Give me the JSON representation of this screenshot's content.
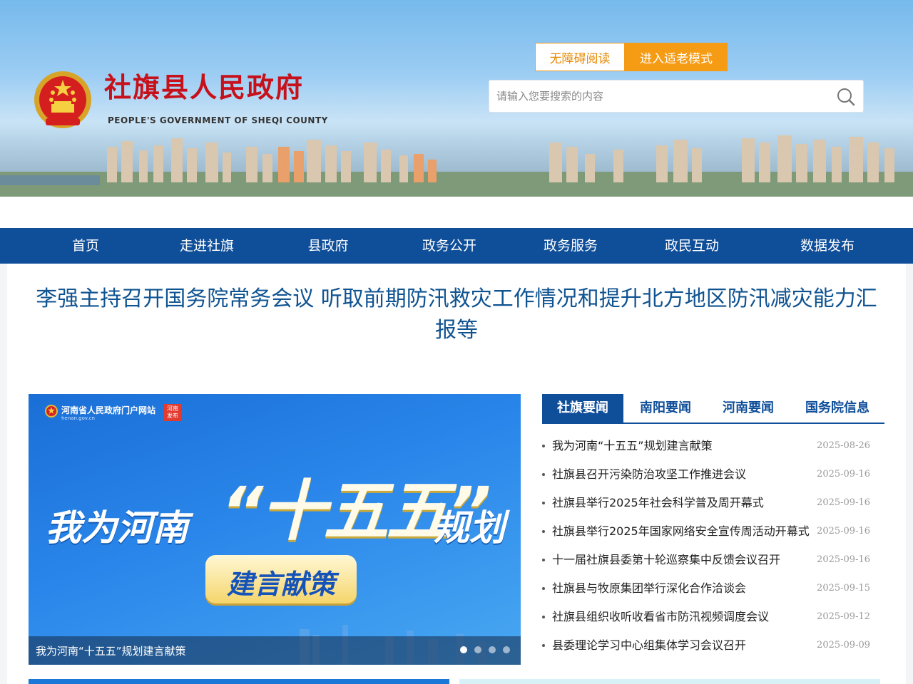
{
  "header": {
    "site_title": "社旗县人民政府",
    "site_subtitle": "PEOPLE'S GOVERNMENT OF  SHEQI COUNTY",
    "accessibility_label": "无障碍阅读",
    "elder_mode_label": "进入适老模式",
    "search_placeholder": "请输入您要搜索的内容"
  },
  "nav": {
    "items": [
      "首页",
      "走进社旗",
      "县政府",
      "政务公开",
      "政务服务",
      "政民互动",
      "数据发布"
    ]
  },
  "headline": "李强主持召开国务院常务会议 听取前期防汛救灾工作情况和提升北方地区防汛减灾能力汇报等",
  "banner": {
    "org_name": "河南省人民政府门户网站",
    "org_url": "henan.gov.cn",
    "badge": "河南发布",
    "text_left": "我为河南",
    "text_mid": "“十五五”",
    "text_right": "规划",
    "text_pill": "建言献策",
    "caption": "我为河南“十五五”规划建言献策",
    "slide_count": 4,
    "active_slide": 1
  },
  "news": {
    "tabs": [
      "社旗要闻",
      "南阳要闻",
      "河南要闻",
      "国务院信息"
    ],
    "active_tab": 0,
    "items": [
      {
        "title": "我为河南“十五五”规划建言献策",
        "date": "2025-08-26"
      },
      {
        "title": "社旗县召开污染防治攻坚工作推进会议",
        "date": "2025-09-16"
      },
      {
        "title": "社旗县举行2025年社会科学普及周开幕式",
        "date": "2025-09-16"
      },
      {
        "title": "社旗县举行2025年国家网络安全宣传周活动开幕式",
        "date": "2025-09-16"
      },
      {
        "title": "十一届社旗县委第十轮巡察集中反馈会议召开",
        "date": "2025-09-16"
      },
      {
        "title": "社旗县与牧原集团举行深化合作洽谈会",
        "date": "2025-09-15"
      },
      {
        "title": "社旗县组织收听收看省市防汛视频调度会议",
        "date": "2025-09-12"
      },
      {
        "title": "县委理论学习中心组集体学习会议召开",
        "date": "2025-09-09"
      }
    ]
  },
  "colors": {
    "nav_blue": "#0f4e99",
    "title_red": "#c7111a",
    "accent_orange": "#f59c14",
    "headline_blue": "#0f5391"
  }
}
